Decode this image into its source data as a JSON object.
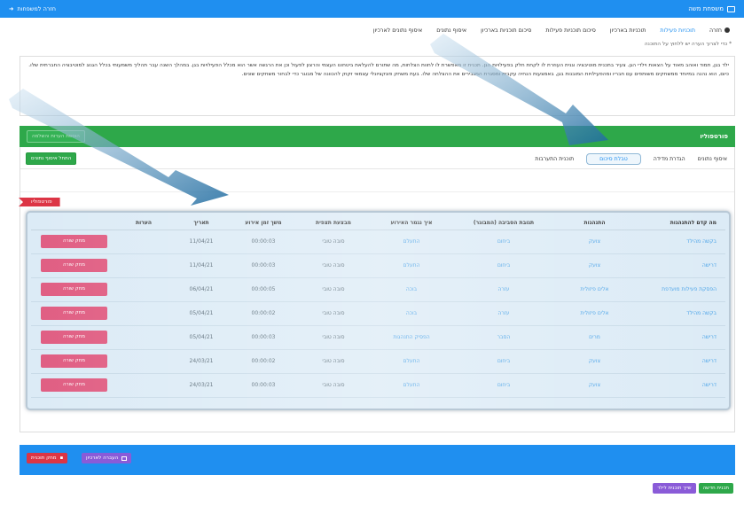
{
  "topbar": {
    "brand": "משפחת משה",
    "back": "חזרה למשפחות"
  },
  "nav": [
    "חזרה",
    "תוכניות פעילות",
    "תוכניות בארכיון",
    "סיכום תוכניות פעילות",
    "סיכום תוכניות בארכיון",
    "איסוף נתונים",
    "איסוף נתונים לארכיון"
  ],
  "notice": "* כדי לצרוך הערה יש ללחוץ על התוכנה",
  "description": "ילד בגן, תמוד ואוהב מאוד על הצאות וילדי הגן. צעיר בתכנית מוטיבציה וגנית העוזרת לו לקחת חלק בפעילויות הגן. תכנית זו מאפשרת לו לחוות הצלחות, מה שתורם להעלאת ביטחונו העצמי והרצון לפעול וכן את הרגשה אשר הוא מכלל הפעילויות בגן. במהלך השנה עבר תהליך משמעותי בכלל הגנוג למוטיבציה החברתית שלו. כיום, הוא נהנה במיוחד ממשחקים משותפים עם חבריו ומהפעילויות המובנות בגן, באמצעות הנחיה עקבית ומסגרת המגבירים את ההצלחה שלו. בעת משחק פונקציונלי עצמאי זקוק להכוונה של מבוגר כדי לבחור משחקים שונים.",
  "portfolio": {
    "title": "פורטפוליו",
    "save_btn": "הוספת הערות והשלמה"
  },
  "tabs": [
    "איסוף נתונים",
    "הגדרת מדידה",
    "טבלת סיכום",
    "תוכנית התערבות"
  ],
  "reset_btn": "התחל איסוף נתונים",
  "tag": "פורטפוליו",
  "table": {
    "headers": [
      "מה קדם להתנהגות",
      "התנהגות",
      "תגובת הסביבה (המבוגר)",
      "איך נגמר האירוע",
      "מבצעת תצפית",
      "משך זמן אירוע",
      "תאריך",
      "הערות",
      ""
    ],
    "rows": [
      [
        "בקשה מהילד",
        "צועק",
        "ביחום",
        "התעלם",
        "סובה טובי",
        "00:00:03",
        "11/04/21",
        "",
        "מחק שורה"
      ],
      [
        "דרישה",
        "צועק",
        "ביחום",
        "התעלם",
        "סובה טובי",
        "00:00:03",
        "11/04/21",
        "",
        "מחק שורה"
      ],
      [
        "הפסקת פעילות מועדפת",
        "אלים פיזולית",
        "עזרה",
        "בוכה",
        "סובה טובי",
        "00:00:05",
        "06/04/21",
        "",
        "מחק שורה"
      ],
      [
        "בקשה מהילד",
        "אלים פיזולית",
        "עזרה",
        "בוכה",
        "סובה טובי",
        "00:00:02",
        "05/04/21",
        "",
        "מחק שורה"
      ],
      [
        "דרישה",
        "מרים",
        "הסבר",
        "הפסיק התנהגות",
        "סובה טובי",
        "00:00:03",
        "05/04/21",
        "",
        "מחק שורה"
      ],
      [
        "דרישה",
        "צועק",
        "ביחום",
        "התעלם",
        "סובה טובי",
        "00:00:02",
        "24/03/21",
        "",
        "מחק שורה"
      ],
      [
        "דרישה",
        "צועק",
        "ביחום",
        "התעלם",
        "סובה טובי",
        "00:00:03",
        "24/03/21",
        "",
        "מחק שורה"
      ]
    ]
  },
  "bottom": {
    "delete_plan": "מחק תוכנית",
    "archive": "העברה לארכיון"
  },
  "footer": {
    "new_plan": "תכנית חדשה",
    "share": "שייך תוכנית לילד"
  },
  "colors": {
    "primary": "#1f8ff0",
    "success": "#2ea84a",
    "danger": "#dc3545",
    "purple": "#8a5bd8"
  }
}
